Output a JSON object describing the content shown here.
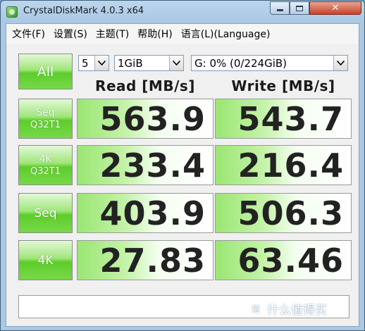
{
  "window": {
    "title": "CrystalDiskMark 4.0.3 x64",
    "controls": {
      "minimize": "minimize",
      "maximize": "maximize",
      "close": "✕"
    }
  },
  "menu": [
    "文件(F)",
    "设置(S)",
    "主题(T)",
    "帮助(H)",
    "语言(L)(Language)"
  ],
  "toolbar": {
    "all_label": "All",
    "count_value": "5",
    "size_value": "1GiB",
    "drive_value": "G: 0% (0/224GiB)"
  },
  "columns": {
    "read": "Read [MB/s]",
    "write": "Write [MB/s]"
  },
  "rows": [
    {
      "label1": "Seq",
      "label2": "Q32T1",
      "read": "563.9",
      "write": "543.7"
    },
    {
      "label1": "4K",
      "label2": "Q32T1",
      "read": "233.4",
      "write": "216.4"
    },
    {
      "label1": "Seq",
      "label2": "",
      "read": "403.9",
      "write": "506.3"
    },
    {
      "label1": "4K",
      "label2": "",
      "read": "27.83",
      "write": "63.46"
    }
  ],
  "comment": "",
  "watermark": {
    "icon": "值",
    "text": "什么值得买"
  },
  "colors": {
    "button_green": "#5ccd2a",
    "bar_green": "#9ae672",
    "title_bg": "#bcd6ec"
  }
}
